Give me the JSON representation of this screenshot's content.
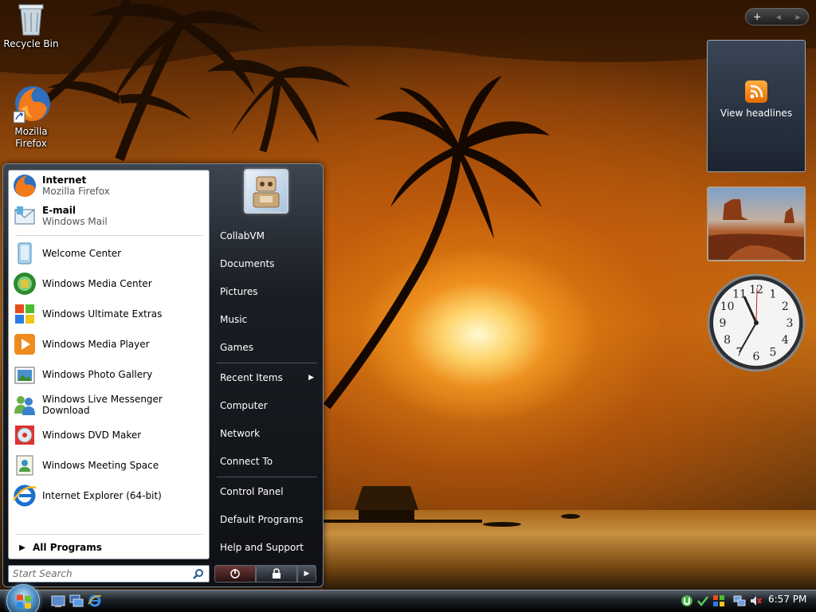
{
  "desktop": {
    "icons": [
      {
        "label": "Recycle Bin"
      },
      {
        "label": "Mozilla Firefox"
      }
    ]
  },
  "gadgets": {
    "toolbar": {
      "add": "+",
      "prev": "◀",
      "next": "▶"
    },
    "feed": {
      "label": "View headlines"
    },
    "clock": {
      "numbers": [
        "12",
        "1",
        "2",
        "3",
        "4",
        "5",
        "6",
        "7",
        "8",
        "9",
        "10",
        "11"
      ]
    }
  },
  "start_menu": {
    "pinned": [
      {
        "title": "Internet",
        "subtitle": "Mozilla Firefox",
        "icon": "firefox-icon"
      },
      {
        "title": "E-mail",
        "subtitle": "Windows Mail",
        "icon": "windows-mail-icon"
      }
    ],
    "recent": [
      {
        "label": "Welcome Center",
        "icon": "welcome-center-icon"
      },
      {
        "label": "Windows Media Center",
        "icon": "media-center-icon"
      },
      {
        "label": "Windows Ultimate Extras",
        "icon": "ultimate-extras-icon"
      },
      {
        "label": "Windows Media Player",
        "icon": "media-player-icon"
      },
      {
        "label": "Windows Photo Gallery",
        "icon": "photo-gallery-icon"
      },
      {
        "label": "Windows Live Messenger Download",
        "icon": "messenger-icon"
      },
      {
        "label": "Windows DVD Maker",
        "icon": "dvd-maker-icon"
      },
      {
        "label": "Windows Meeting Space",
        "icon": "meeting-space-icon"
      },
      {
        "label": "Internet Explorer (64-bit)",
        "icon": "internet-explorer-icon"
      }
    ],
    "all_programs": "All Programs",
    "search_placeholder": "Start Search",
    "right_items": [
      {
        "label": "CollabVM"
      },
      {
        "label": "Documents"
      },
      {
        "label": "Pictures"
      },
      {
        "label": "Music"
      },
      {
        "label": "Games"
      },
      {
        "label": "Recent Items"
      },
      {
        "label": "Computer"
      },
      {
        "label": "Network"
      },
      {
        "label": "Connect To"
      },
      {
        "label": "Control Panel"
      },
      {
        "label": "Default Programs"
      },
      {
        "label": "Help and Support"
      }
    ]
  },
  "taskbar": {
    "clock": "6:57 PM"
  }
}
